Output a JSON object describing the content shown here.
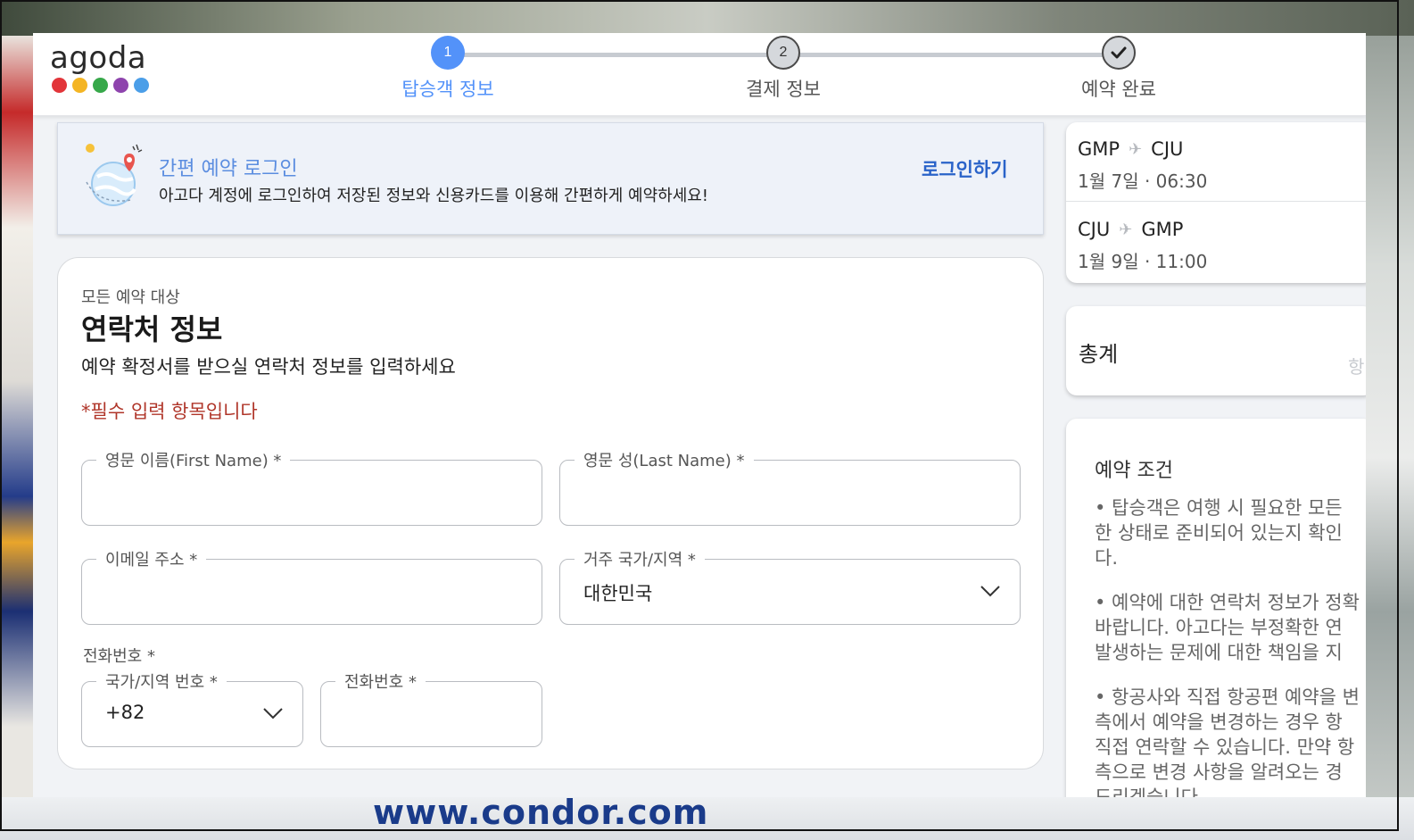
{
  "brand": {
    "name": "agoda",
    "dot_colors": [
      "#e2353a",
      "#f4b524",
      "#37a84a",
      "#8e44ad",
      "#4b9ee8"
    ]
  },
  "stepper": {
    "steps": [
      {
        "number": "1",
        "label": "탑승객 정보",
        "state": "active"
      },
      {
        "number": "2",
        "label": "결제 정보",
        "state": "idle"
      },
      {
        "number": "",
        "label": "예약 완료",
        "state": "done",
        "icon": "check-icon"
      }
    ]
  },
  "login_banner": {
    "title": "간편 예약 로그인",
    "description": "아고다 계정에 로그인하여 저장된 정보와 신용카드를 이용해 간편하게 예약하세요!",
    "action": "로그인하기"
  },
  "contact": {
    "eyebrow": "모든 예약 대상",
    "title": "연락처 정보",
    "subtitle": "예약 확정서를 받으실 연락처 정보를 입력하세요",
    "required_note": "*필수 입력 항목입니다",
    "first_name": {
      "label": "영문 이름(First Name) *",
      "value": ""
    },
    "last_name": {
      "label": "영문 성(Last Name) *",
      "value": ""
    },
    "email": {
      "label": "이메일 주소 *",
      "value": ""
    },
    "country": {
      "label": "거주 국가/지역 *",
      "value": "대한민국"
    },
    "phone_group_label": "전화번호 *",
    "country_code": {
      "label": "국가/지역 번호 *",
      "value": "+82"
    },
    "phone": {
      "label": "전화번호 *",
      "value": ""
    }
  },
  "flights": [
    {
      "from": "GMP",
      "to": "CJU",
      "time": "1월 7일 · 06:30"
    },
    {
      "from": "CJU",
      "to": "GMP",
      "time": "1월 9일 · 11:00"
    }
  ],
  "total": {
    "label": "총계",
    "faded_text": "항"
  },
  "terms": {
    "title": "예약 조건",
    "paragraphs": [
      [
        "• 탑승객은 여행 시 필요한 모든",
        "한 상태로 준비되어 있는지 확인",
        "다."
      ],
      [
        "• 예약에 대한 연락처 정보가 정확",
        "바랍니다. 아고다는 부정확한 연",
        "발생하는 문제에 대한 책임을 지"
      ],
      [
        "• 항공사와 직접 항공편 예약을 변",
        "측에서 예약을 변경하는 경우 항",
        "직접 연락할 수 있습니다. 만약 항",
        "측으로 변경 사항을 알려오는 경",
        "드리겠습니다."
      ]
    ]
  },
  "background": {
    "watermark": "www.condor.com"
  }
}
